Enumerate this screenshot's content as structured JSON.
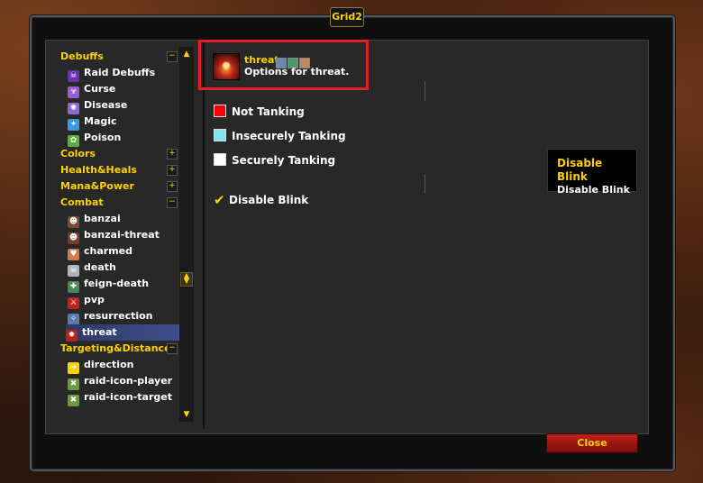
{
  "window_title": "Grid2",
  "header": {
    "title": "threat",
    "description": "Options for threat."
  },
  "tree": [
    {
      "label": "Debuffs",
      "kind": "group",
      "expander": "−",
      "icon": null
    },
    {
      "label": "Raid Debuffs",
      "kind": "child",
      "icon": "raid-debuffs-icon",
      "color": "#6a2fb0"
    },
    {
      "label": "Curse",
      "kind": "child",
      "icon": "curse-icon",
      "color": "#9a5ad0"
    },
    {
      "label": "Disease",
      "kind": "child",
      "icon": "disease-icon",
      "color": "#8a6ad0"
    },
    {
      "label": "Magic",
      "kind": "child",
      "icon": "magic-icon",
      "color": "#3a9adf"
    },
    {
      "label": "Poison",
      "kind": "child",
      "icon": "poison-icon",
      "color": "#5ab03a"
    },
    {
      "label": "Colors",
      "kind": "group",
      "expander": "+",
      "icon": null
    },
    {
      "label": "Health&Heals",
      "kind": "group",
      "expander": "+",
      "icon": null
    },
    {
      "label": "Mana&Power",
      "kind": "group",
      "expander": "+",
      "icon": null
    },
    {
      "label": "Combat",
      "kind": "group",
      "expander": "−",
      "icon": null
    },
    {
      "label": "banzai",
      "kind": "child",
      "icon": "banzai-icon",
      "color": "#7a4a2a"
    },
    {
      "label": "banzai-threat",
      "kind": "child",
      "icon": "banzai-threat-icon",
      "color": "#7a3a2a"
    },
    {
      "label": "charmed",
      "kind": "child",
      "icon": "charmed-icon",
      "color": "#d07a4a"
    },
    {
      "label": "death",
      "kind": "child",
      "icon": "death-icon",
      "color": "#b0b0c0"
    },
    {
      "label": "feign-death",
      "kind": "child",
      "icon": "feign-death-icon",
      "color": "#4a8a5a"
    },
    {
      "label": "pvp",
      "kind": "child",
      "icon": "pvp-icon",
      "color": "#c02020"
    },
    {
      "label": "resurrection",
      "kind": "child",
      "icon": "resurrection-icon",
      "color": "#5a7ab0"
    },
    {
      "label": "threat",
      "kind": "child",
      "icon": "threat-icon",
      "color": "#b8241a",
      "selected": true
    },
    {
      "label": "Targeting&Distances",
      "kind": "group",
      "expander": "−",
      "icon": null
    },
    {
      "label": "direction",
      "kind": "child",
      "icon": "arrow-icon",
      "color": "#ffd100"
    },
    {
      "label": "raid-icon-player",
      "kind": "child",
      "icon": "raid-marker-icon",
      "color": "#6a9a3a"
    },
    {
      "label": "raid-icon-target",
      "kind": "child",
      "icon": "raid-marker-icon",
      "color": "#6a9a3a"
    }
  ],
  "options": {
    "not_tanking": {
      "label": "Not Tanking",
      "color": "#ff0000"
    },
    "insecurely_tanking": {
      "label": "Insecurely Tanking",
      "color": "#7fe6ee"
    },
    "securely_tanking": {
      "label": "Securely Tanking",
      "color": "#ffffff"
    },
    "disable_blink": {
      "label": "Disable Blink",
      "checked": true
    }
  },
  "tooltip": {
    "title": "Disable Blink",
    "body": "Disable Blink"
  },
  "close_label": "Close"
}
